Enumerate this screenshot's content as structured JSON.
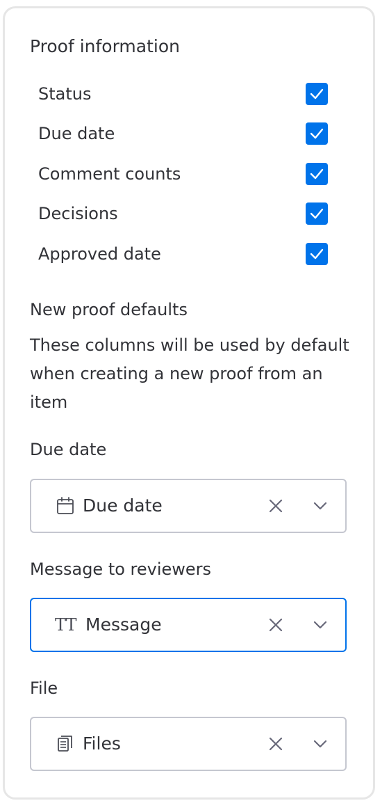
{
  "proof_information": {
    "title": "Proof information",
    "items": [
      {
        "label": "Status",
        "checked": true
      },
      {
        "label": "Due date",
        "checked": true
      },
      {
        "label": "Comment counts",
        "checked": true
      },
      {
        "label": "Decisions",
        "checked": true
      },
      {
        "label": "Approved date",
        "checked": true
      }
    ]
  },
  "new_proof_defaults": {
    "title": "New proof defaults",
    "description": "These columns will be used by default when creating a new proof from an item"
  },
  "fields": {
    "due_date": {
      "label": "Due date",
      "value": "Due date",
      "icon": "calendar-icon"
    },
    "message": {
      "label": "Message to reviewers",
      "value": "Message",
      "icon": "text-icon",
      "tt": "TT"
    },
    "file": {
      "label": "File",
      "value": "Files",
      "icon": "file-icon"
    }
  },
  "colors": {
    "accent": "#0073ea",
    "text": "#323338",
    "border": "#c5c7d0"
  }
}
